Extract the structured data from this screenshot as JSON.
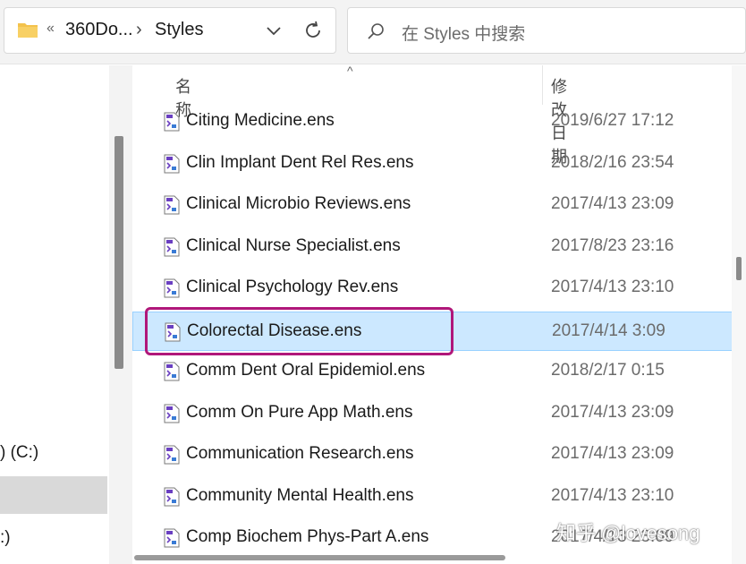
{
  "address": {
    "sep1": "«",
    "parent": "360Do...",
    "sep2": "›",
    "current": "Styles"
  },
  "search": {
    "placeholder": "在 Styles 中搜索"
  },
  "nav": {
    "items": [
      {
        "label": ") (C:)"
      },
      {
        "label": ":)"
      }
    ]
  },
  "columns": {
    "name": "名称",
    "date": "修改日期"
  },
  "files": [
    {
      "name": "Citing Medicine.ens",
      "date": "2019/6/27 17:12"
    },
    {
      "name": "Clin Implant Dent Rel Res.ens",
      "date": "2018/2/16 23:54"
    },
    {
      "name": "Clinical Microbio Reviews.ens",
      "date": "2017/4/13 23:09"
    },
    {
      "name": "Clinical Nurse Specialist.ens",
      "date": "2017/8/23 23:16"
    },
    {
      "name": "Clinical Psychology Rev.ens",
      "date": "2017/4/13 23:10"
    },
    {
      "name": "Colorectal Disease.ens",
      "date": "2017/4/14 3:09"
    },
    {
      "name": "Comm Dent Oral Epidemiol.ens",
      "date": "2018/2/17 0:15"
    },
    {
      "name": "Comm On Pure App Math.ens",
      "date": "2017/4/13 23:09"
    },
    {
      "name": "Communication Research.ens",
      "date": "2017/4/13 23:09"
    },
    {
      "name": "Community Mental Health.ens",
      "date": "2017/4/13 23:10"
    },
    {
      "name": "Comp Biochem Phys-Part A.ens",
      "date": "2017/4/13 23:09"
    }
  ],
  "watermark": "知乎 @lovesong",
  "colors": {
    "selection": "#cce8ff",
    "highlight": "#b0177a",
    "accent": "#6a3fc1"
  }
}
